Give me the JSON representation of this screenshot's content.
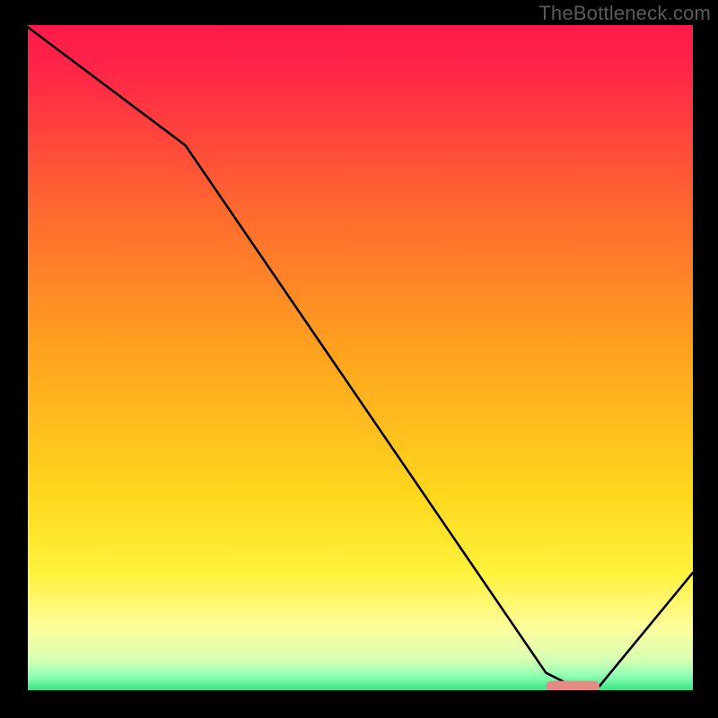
{
  "watermark": "TheBottleneck.com",
  "chart_data": {
    "type": "line",
    "title": "",
    "xlabel": "",
    "ylabel": "",
    "xlim": [
      0,
      100
    ],
    "ylim": [
      0,
      100
    ],
    "x": [
      0,
      24,
      78,
      82,
      86,
      100
    ],
    "values": [
      100,
      82,
      3,
      1,
      1,
      18
    ],
    "optimal_marker": {
      "x_start": 78,
      "x_end": 86,
      "y": 1
    },
    "gradient_stops": [
      {
        "pos": 0.0,
        "color": "#ff1a4b"
      },
      {
        "pos": 0.07,
        "color": "#ff2647"
      },
      {
        "pos": 0.28,
        "color": "#ff6a2f"
      },
      {
        "pos": 0.5,
        "color": "#ffa51e"
      },
      {
        "pos": 0.7,
        "color": "#ffd61e"
      },
      {
        "pos": 0.82,
        "color": "#fff23c"
      },
      {
        "pos": 0.9,
        "color": "#fffc9a"
      },
      {
        "pos": 0.95,
        "color": "#d8ffb3"
      },
      {
        "pos": 0.975,
        "color": "#8dffb3"
      },
      {
        "pos": 1.0,
        "color": "#28e07c"
      }
    ],
    "marker_color": "#e68a86"
  }
}
